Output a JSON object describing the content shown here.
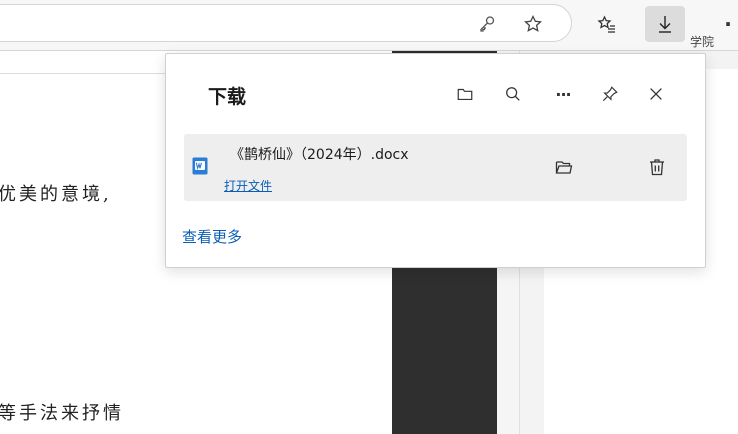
{
  "toolbar": {
    "key_icon": "key-icon",
    "favorite_icon": "star-icon",
    "favorites_list_icon": "favorites-list-icon",
    "downloads_icon": "download-arrow-icon",
    "more_label": "·"
  },
  "document": {
    "lines": [
      "优美的意境,",
      "等手法来抒情"
    ]
  },
  "side_panel": {
    "text": "学院"
  },
  "downloads": {
    "title": "下载",
    "header_icons": [
      "folder-icon",
      "search-icon",
      "more-icon",
      "pin-icon",
      "close-icon"
    ],
    "more_label": "···",
    "items": [
      {
        "file_name": "《鹊桥仙》（2024年）.docx",
        "action_label": "打开文件",
        "file_type_icon": "word-doc-icon",
        "folder_icon": "open-folder-icon",
        "delete_icon": "trash-icon"
      }
    ],
    "see_more_label": "查看更多"
  },
  "colors": {
    "link": "#0a5db8",
    "item_bg": "#eeeeee",
    "word_blue": "#2b7cd3"
  }
}
